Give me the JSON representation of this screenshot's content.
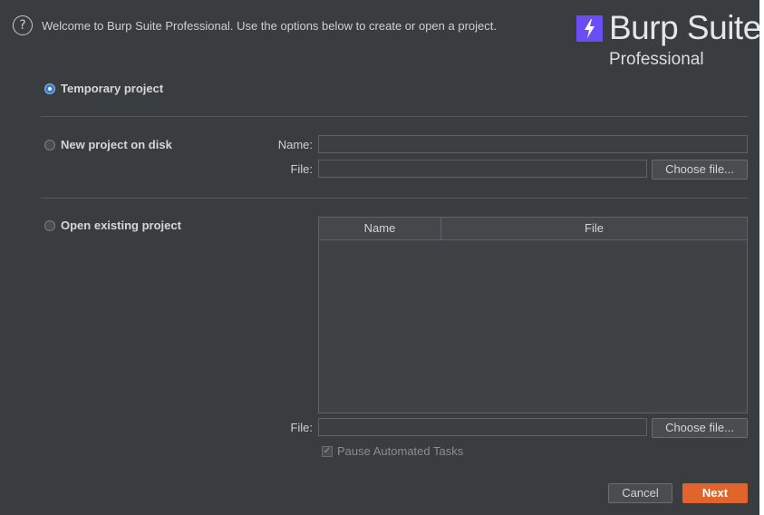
{
  "header": {
    "help_glyph": "?",
    "welcome_text": "Welcome to Burp Suite Professional. Use the options below to create or open a project.",
    "logo_text": "Burp Suite",
    "logo_subtext": "Professional",
    "logo_color": "#6b4df5"
  },
  "options": {
    "temporary": {
      "label": "Temporary project",
      "selected": true
    },
    "new_on_disk": {
      "label": "New project on disk",
      "name_label": "Name:",
      "name_value": "",
      "file_label": "File:",
      "file_value": "",
      "choose_label": "Choose file..."
    },
    "open_existing": {
      "label": "Open existing project",
      "table_headers": [
        "Name",
        "File"
      ],
      "file_label": "File:",
      "file_value": "",
      "choose_label": "Choose file...",
      "pause_label": "Pause Automated Tasks",
      "pause_checked": true
    }
  },
  "footer": {
    "cancel_label": "Cancel",
    "next_label": "Next",
    "next_color": "#e0642c"
  }
}
